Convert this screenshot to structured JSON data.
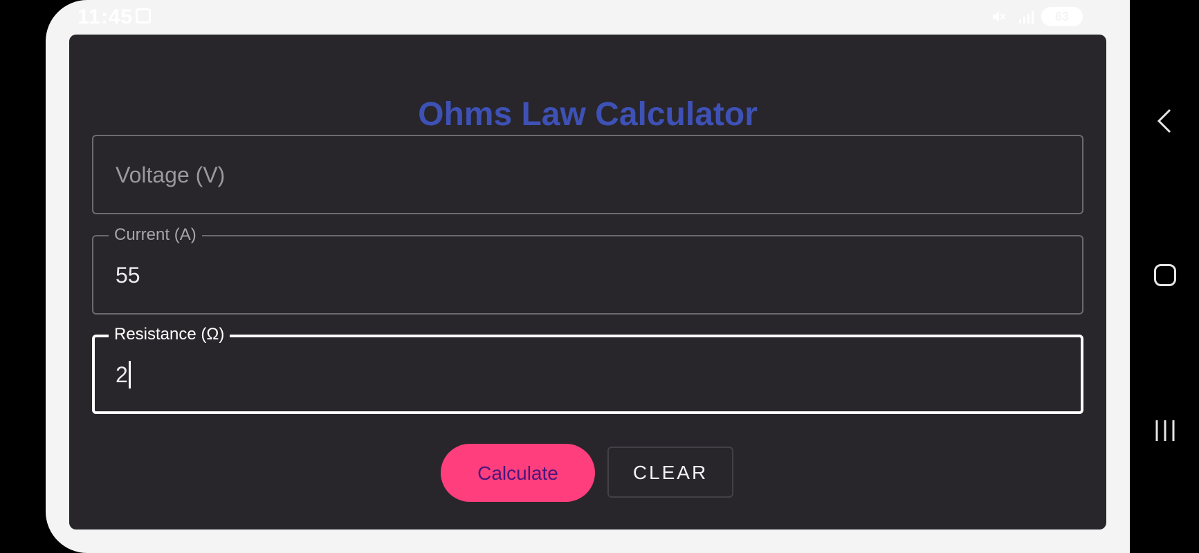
{
  "status_bar": {
    "time": "11:45",
    "battery": "63"
  },
  "app": {
    "title": "Ohms Law Calculator",
    "fields": {
      "voltage": {
        "placeholder": "Voltage (V)",
        "value": ""
      },
      "current": {
        "label": "Current (A)",
        "value": "55"
      },
      "resistance": {
        "label": "Resistance (Ω)",
        "value": "2"
      }
    },
    "buttons": {
      "calculate": "Calculate",
      "clear": "CLEAR"
    }
  },
  "colors": {
    "title": "#3e51b5",
    "calculate_bg": "#ff3e7e",
    "card_bg": "#28262b"
  },
  "nav_icons": [
    "back-icon",
    "home-icon",
    "recents-icon"
  ]
}
